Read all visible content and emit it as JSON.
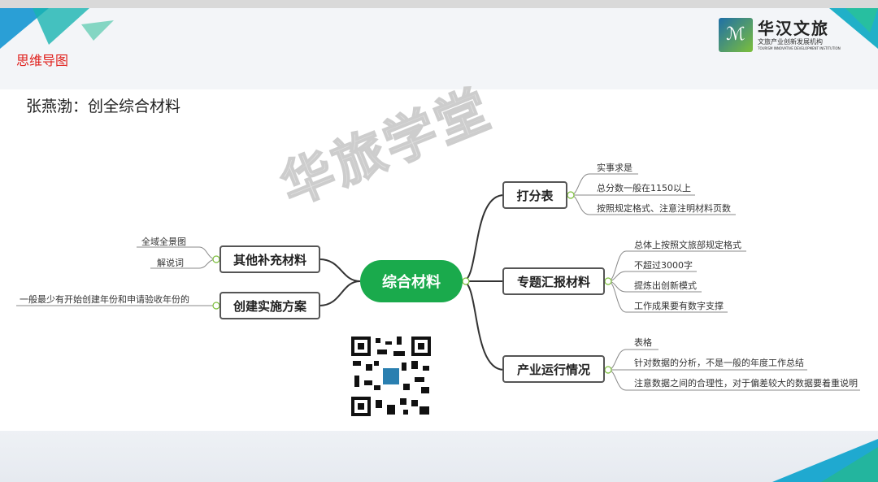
{
  "header": {
    "section_label": "思维导图",
    "logo_title": "华汉文旅",
    "logo_subtitle": "文旅产业创新发展机构",
    "logo_english": "TOURISM INNOVATIVE DEVELOPMENT INSTITUTION"
  },
  "page_title": "张燕渤：创全综合材料",
  "watermark": "华旅学堂",
  "mindmap": {
    "center": "综合材料",
    "right": [
      {
        "label": "打分表",
        "children": [
          "实事求是",
          "总分数一般在1150以上",
          "按照规定格式、注意注明材料页数"
        ]
      },
      {
        "label": "专题汇报材料",
        "children": [
          "总体上按照文旅部规定格式",
          "不超过3000字",
          "提炼出创新模式",
          "工作成果要有数字支撑"
        ]
      },
      {
        "label": "产业运行情况",
        "children": [
          "表格",
          "针对数据的分析，不是一般的年度工作总结",
          "注意数据之间的合理性，对于偏差较大的数据要着重说明"
        ]
      }
    ],
    "left": [
      {
        "label": "其他补充材料",
        "children": [
          "全域全景图",
          "解说词"
        ]
      },
      {
        "label": "创建实施方案",
        "children": [
          "一般最少有开始创建年份和申请验收年份的"
        ]
      }
    ]
  },
  "colors": {
    "accent": "#1aaa4c",
    "red": "#e0201c"
  }
}
